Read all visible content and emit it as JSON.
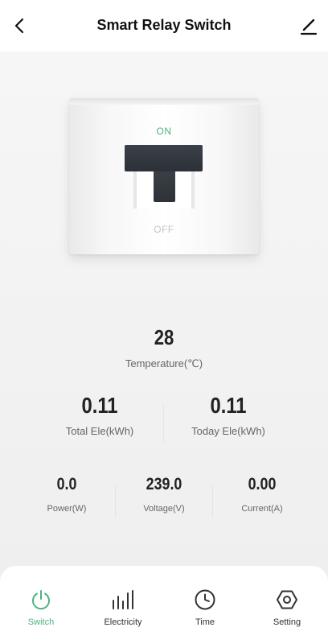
{
  "header": {
    "title": "Smart Relay Switch"
  },
  "breaker": {
    "on_label": "ON",
    "off_label": "OFF",
    "state": "on"
  },
  "readings": {
    "temperature": {
      "value": "28",
      "label": "Temperature(℃)"
    },
    "total_ele": {
      "value": "0.11",
      "label": "Total Ele(kWh)"
    },
    "today_ele": {
      "value": "0.11",
      "label": "Today Ele(kWh)"
    },
    "power": {
      "value": "0.0",
      "label": "Power(W)"
    },
    "voltage": {
      "value": "239.0",
      "label": "Voltage(V)"
    },
    "current": {
      "value": "0.00",
      "label": "Current(A)"
    }
  },
  "nav": {
    "items": [
      {
        "label": "Switch",
        "icon": "power-icon",
        "active": true
      },
      {
        "label": "Electricity",
        "icon": "bar-chart-icon",
        "active": false
      },
      {
        "label": "Time",
        "icon": "clock-icon",
        "active": false
      },
      {
        "label": "Setting",
        "icon": "hexagon-settings-icon",
        "active": false
      }
    ]
  },
  "colors": {
    "accent": "#4cb37f",
    "lever": "#2e3238",
    "text": "#222222",
    "muted": "#666666"
  }
}
